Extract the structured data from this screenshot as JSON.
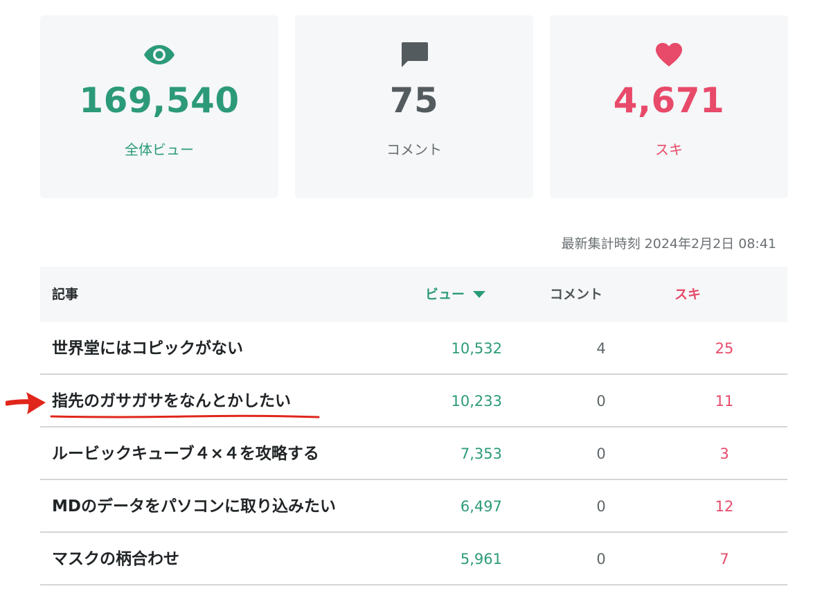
{
  "stats": {
    "views": {
      "value": "169,540",
      "label": "全体ビュー",
      "icon": "eye-icon",
      "color": "#2c9a79"
    },
    "comments": {
      "value": "75",
      "label": "コメント",
      "icon": "comment-icon",
      "color": "#545b5e"
    },
    "likes": {
      "value": "4,671",
      "label": "スキ",
      "icon": "heart-icon",
      "color": "#e84a6a"
    }
  },
  "timestamp": "最新集計時刻 2024年2月2日 08:41",
  "table": {
    "headers": {
      "article": "記事",
      "views": "ビュー",
      "comments": "コメント",
      "likes": "スキ"
    },
    "sort": {
      "column": "views",
      "direction": "descending"
    },
    "rows": [
      {
        "title": "世界堂にはコピックがない",
        "views": "10,532",
        "comments": "4",
        "likes": "25"
      },
      {
        "title": "指先のガサガサをなんとかしたい",
        "views": "10,233",
        "comments": "0",
        "likes": "11"
      },
      {
        "title": "ルービックキューブ４×４を攻略する",
        "views": "7,353",
        "comments": "0",
        "likes": "3"
      },
      {
        "title": "MDのデータをパソコンに取り込みたい",
        "views": "6,497",
        "comments": "0",
        "likes": "12"
      },
      {
        "title": "マスクの柄合わせ",
        "views": "5,961",
        "comments": "0",
        "likes": "7"
      }
    ]
  },
  "annotation": {
    "color": "#e0261b",
    "highlighted_row": 1
  }
}
